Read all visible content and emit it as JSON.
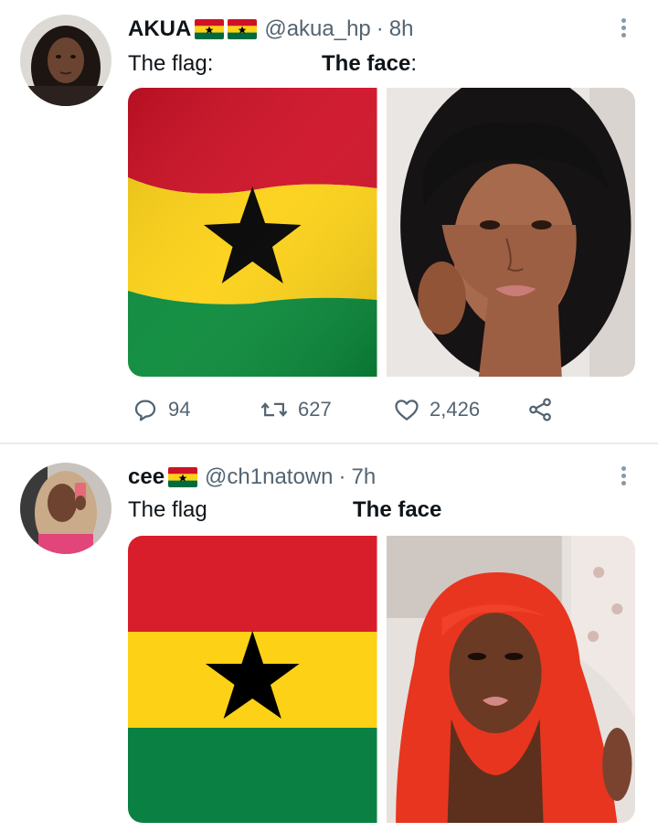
{
  "tweets": [
    {
      "display_name": "AKUA",
      "handle": "@akua_hp",
      "separator": "·",
      "time": "8h",
      "text_left": "The flag:",
      "text_right": "The face",
      "text_right_suffix": ":",
      "stats": {
        "replies": "94",
        "retweets": "627",
        "likes": "2,426"
      }
    },
    {
      "display_name": "cee",
      "handle": "@ch1natown",
      "separator": "·",
      "time": "7h",
      "text_left": "The flag",
      "text_right": "The face"
    }
  ],
  "colors": {
    "flag_red": "#ce1126",
    "flag_gold": "#fcd116",
    "flag_green": "#006b3f",
    "star": "#000000",
    "muted_text": "#536471",
    "divider": "#e6ecf0"
  },
  "icons": [
    "reply-icon",
    "retweet-icon",
    "like-icon",
    "share-icon",
    "more-icon"
  ]
}
